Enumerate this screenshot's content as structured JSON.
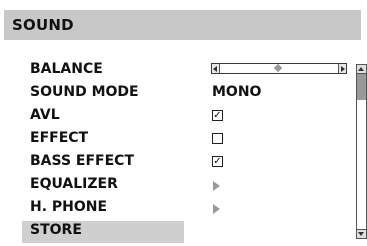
{
  "title": "SOUND",
  "menu": {
    "items": [
      {
        "label": "BALANCE"
      },
      {
        "label": "SOUND MODE",
        "value": "MONO"
      },
      {
        "label": "AVL",
        "checked": true
      },
      {
        "label": "EFFECT",
        "checked": false
      },
      {
        "label": "BASS EFFECT",
        "checked": true
      },
      {
        "label": "EQUALIZER"
      },
      {
        "label": "H. PHONE"
      },
      {
        "label": "STORE",
        "selected": true
      }
    ],
    "balance_position": 0.5,
    "check_mark": "✓"
  },
  "colors": {
    "title_bar": "#c8c8c8",
    "selected_row": "#cfcfcf",
    "arrow": "#9a9a9a"
  },
  "icons": [
    "left-arrow-icon",
    "right-arrow-icon",
    "diamond-thumb-icon",
    "submenu-arrow-icon",
    "scroll-up-icon",
    "scroll-down-icon"
  ]
}
